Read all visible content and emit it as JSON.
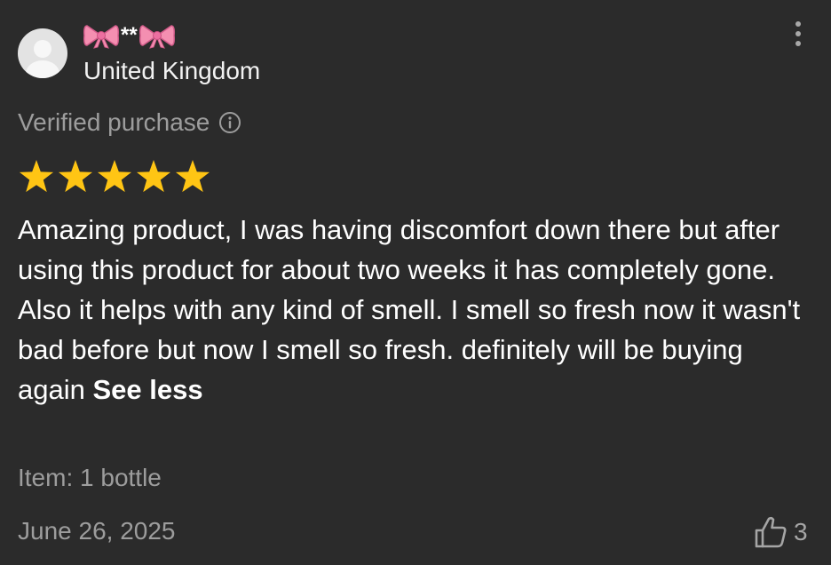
{
  "reviewer": {
    "name_masked": "**",
    "name_decoration_icon": "bow-emoji",
    "location": "United Kingdom",
    "avatar_icon": "default-avatar"
  },
  "meta": {
    "verified_label": "Verified purchase",
    "info_icon": "info-circle-icon"
  },
  "rating": {
    "stars": 5,
    "max": 5,
    "star_color": "#FFC514"
  },
  "review": {
    "text": "Amazing product, I was having discomfort down there but after using this product for about two weeks it has completely gone. Also it helps with any kind of smell. I smell so fresh now it wasn't bad before but now I smell so fresh. definitely will be buying again",
    "toggle_label": "See less"
  },
  "item": {
    "label": "Item: 1 bottle"
  },
  "footer": {
    "date": "June 26, 2025",
    "like_count": "3",
    "like_icon": "thumbs-up-icon"
  },
  "colors": {
    "background": "#2B2B2B",
    "primary_text": "#FFFFFF",
    "secondary_text": "#9D9D9D",
    "bow_pink": "#F48FB1"
  }
}
